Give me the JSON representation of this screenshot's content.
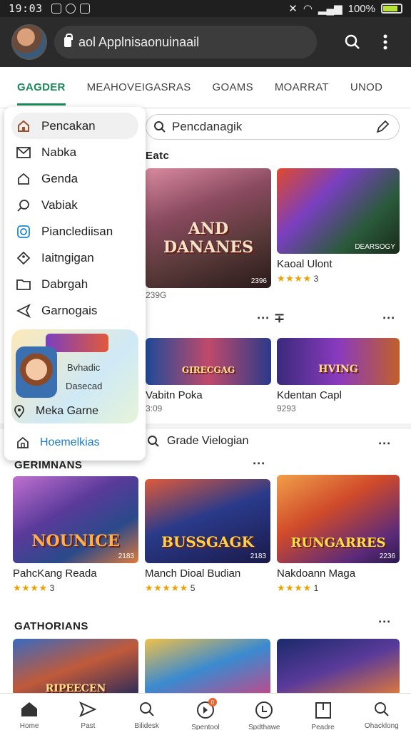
{
  "status_bar": {
    "time": "19:03",
    "battery": "100%",
    "battery_level": 0.85
  },
  "browser": {
    "url": "aol Applnisaonuinaail"
  },
  "tabs": [
    {
      "label": "GAGDER",
      "active": true
    },
    {
      "label": "MEAHOVEIGASRAS"
    },
    {
      "label": "GOAMS"
    },
    {
      "label": "MOARRAT"
    },
    {
      "label": "UNOD"
    }
  ],
  "drawer": {
    "items": [
      {
        "label": "Pencakan",
        "icon": "home-icon"
      },
      {
        "label": "Nabka",
        "icon": "mail-icon"
      },
      {
        "label": "Genda",
        "icon": "house-icon"
      },
      {
        "label": "Vabiak",
        "icon": "search-icon"
      },
      {
        "label": "Pianclediisan",
        "icon": "target-icon"
      },
      {
        "label": "Iaitngigan",
        "icon": "tag-icon"
      },
      {
        "label": "Dabrgah",
        "icon": "folder-icon"
      },
      {
        "label": "Garnogais",
        "icon": "send-icon"
      }
    ],
    "promo": {
      "line1": "Bvhadic",
      "line2": "Dasecad",
      "cta": "Meka Garne"
    },
    "footer": "Hoemelkias"
  },
  "search": {
    "placeholder": "Pencdanagik"
  },
  "sections": {
    "first": "Eatc",
    "second_left": "∙∙∙ ∓",
    "third": "Grade Vielogian",
    "fourth": "GERIMNANS",
    "fifth": "GATHORIANS"
  },
  "top_cards": [
    {
      "overlay": "AND DANANES",
      "tag": "2396",
      "meta": "239G"
    },
    {
      "overlay": "",
      "tag": "DEARSOGY",
      "name": "Kaoal Ulont",
      "stars": "★★★★",
      "rating": "3"
    }
  ],
  "row2_cards": [
    {
      "overlay": "GIRECGAG",
      "name": "Vabitn Poka",
      "meta": "3:09"
    },
    {
      "overlay": "HVING",
      "name": "Kdentan Capl",
      "meta": "9293"
    }
  ],
  "row3_cards": [
    {
      "overlay": "NOUNICE",
      "tag": "2183",
      "name": "PahcKang Reada",
      "stars": "★★★★",
      "rating": "3"
    },
    {
      "overlay": "BUSSGAGK",
      "tag": "2183",
      "name": "Manch Dioal Budian",
      "stars": "★★★★★",
      "rating": "5"
    },
    {
      "overlay": "RUNGARRES",
      "tag": "2236",
      "name": "Nakdoann Maga",
      "stars": "★★★★",
      "rating": "1"
    }
  ],
  "row4_cards": [
    {
      "overlay": "RIPEECEN"
    },
    {
      "overlay": ""
    },
    {
      "overlay": ""
    }
  ],
  "bottom_nav": [
    {
      "icon": "home-icon",
      "label": "Home"
    },
    {
      "icon": "send-icon",
      "label": "Past"
    },
    {
      "icon": "search-icon",
      "label": "Bilidesk"
    },
    {
      "icon": "alert-icon",
      "label": "Spentool",
      "badge": "0"
    },
    {
      "icon": "clock-icon",
      "label": "Spdthawe"
    },
    {
      "icon": "archive-icon",
      "label": "Peadre"
    },
    {
      "icon": "search-icon",
      "label": "Ohacklong"
    }
  ]
}
